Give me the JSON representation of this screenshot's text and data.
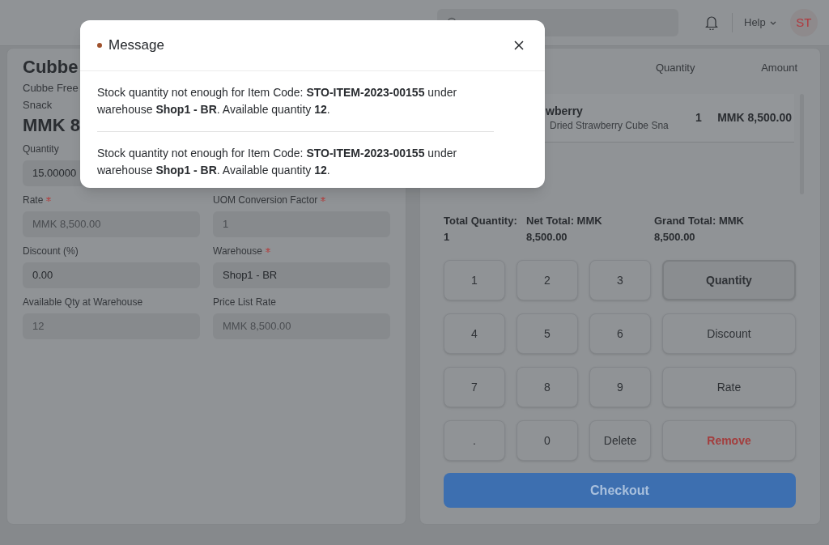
{
  "navbar": {
    "help_menu": "Help",
    "avatar": "ST"
  },
  "item": {
    "name": "Cubbe",
    "description_lines": [
      "Cubbe Free",
      "Snack"
    ],
    "price": "MMK 8"
  },
  "fields": [
    {
      "label": "Quantity",
      "required": false,
      "value": "15.00000",
      "readonly": false
    },
    {
      "label": "Rate",
      "required": true,
      "value": "MMK 8,500.00",
      "readonly": true
    },
    {
      "label": "UOM Conversion Factor",
      "required": true,
      "value": "1",
      "readonly": true
    },
    {
      "label": "Discount (%)",
      "required": false,
      "value": "0.00",
      "readonly": false
    },
    {
      "label": "Warehouse",
      "required": true,
      "value": "Shop1 - BR",
      "readonly": false
    },
    {
      "label": "Available Qty at Warehouse",
      "required": false,
      "value": "12",
      "readonly": true
    },
    {
      "label": "Price List Rate",
      "required": false,
      "value": "MMK 8,500.00",
      "readonly": true
    }
  ],
  "cart": {
    "columns": [
      "Quantity",
      "Amount"
    ],
    "items": [
      {
        "name": "wberry",
        "description": "Dried Strawberry Cube Sna",
        "quantity": "1",
        "amount": "MMK 8,500.00"
      }
    ]
  },
  "totals": [
    {
      "label": "Total Quantity:",
      "value": "1"
    },
    {
      "label": "Net Total: MMK",
      "value": "8,500.00"
    },
    {
      "label": "Grand Total: MMK",
      "value": "8,500.00"
    }
  ],
  "keypad": [
    {
      "label": "1",
      "kind": "digit",
      "selected": false
    },
    {
      "label": "2",
      "kind": "digit",
      "selected": false
    },
    {
      "label": "3",
      "kind": "digit",
      "selected": false
    },
    {
      "label": "Quantity",
      "kind": "mode",
      "selected": true
    },
    {
      "label": "4",
      "kind": "digit",
      "selected": false
    },
    {
      "label": "5",
      "kind": "digit",
      "selected": false
    },
    {
      "label": "6",
      "kind": "digit",
      "selected": false
    },
    {
      "label": "Discount",
      "kind": "mode",
      "selected": false
    },
    {
      "label": "7",
      "kind": "digit",
      "selected": false
    },
    {
      "label": "8",
      "kind": "digit",
      "selected": false
    },
    {
      "label": "9",
      "kind": "digit",
      "selected": false
    },
    {
      "label": "Rate",
      "kind": "mode",
      "selected": false
    },
    {
      "label": ".",
      "kind": "digit",
      "selected": false
    },
    {
      "label": "0",
      "kind": "digit",
      "selected": false
    },
    {
      "label": "Delete",
      "kind": "digit",
      "selected": false
    },
    {
      "label": "Remove",
      "kind": "remove",
      "selected": false
    }
  ],
  "checkout": "Checkout",
  "modal": {
    "title": "Message",
    "messages": [
      "Stock quantity not enough for Item Code: **STO-ITEM-2023-00155** under warehouse **Shop1 - BR**. Available quantity **12**.",
      "Stock quantity not enough for Item Code: **STO-ITEM-2023-00155** under warehouse **Shop1 - BR**. Available quantity **12**."
    ]
  }
}
